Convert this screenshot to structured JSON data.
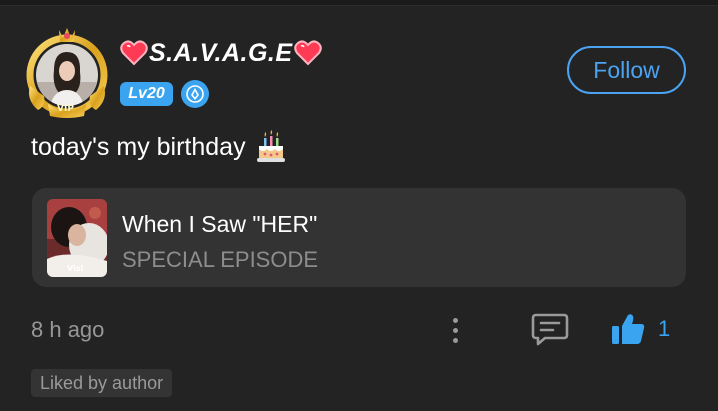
{
  "user": {
    "name": "S.A.V.A.G.E",
    "level": "Lv20",
    "vip_label": "VIP"
  },
  "follow_button": {
    "label": "Follow"
  },
  "post": {
    "text": "today's my birthday"
  },
  "episode": {
    "title": "When I Saw \"HER\"",
    "subtitle": "SPECIAL EPISODE",
    "thumb_text": "Visi"
  },
  "footer": {
    "time_ago": "8 h ago",
    "like_count": "1",
    "liked_by_author": "Liked by author"
  },
  "colors": {
    "background": "#232323",
    "accent": "#3aa4f1",
    "card": "#333333",
    "muted_text": "#979797"
  },
  "icons": [
    "heart-icon",
    "shield-icon",
    "cake-icon",
    "more-icon",
    "comment-icon",
    "thumbs-up-icon"
  ]
}
